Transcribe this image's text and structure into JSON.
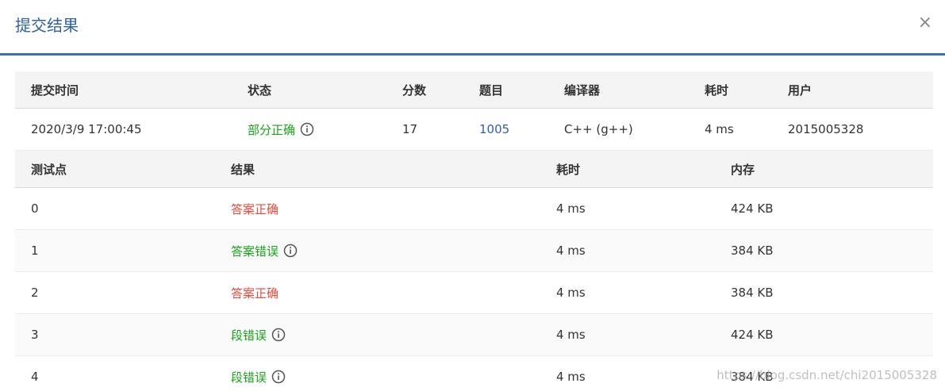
{
  "dialog": {
    "title": "提交结果",
    "close_label": "×"
  },
  "submission": {
    "headers": [
      "提交时间",
      "状态",
      "分数",
      "题目",
      "编译器",
      "耗时",
      "用户"
    ],
    "values": {
      "time": "2020/3/9 17:00:45",
      "status": "部分正确",
      "score": "17",
      "problem": "1005",
      "compiler": "C++ (g++)",
      "duration": "4 ms",
      "user": "2015005328"
    }
  },
  "testcases": {
    "headers": [
      "测试点",
      "结果",
      "耗时",
      "内存"
    ],
    "rows": [
      {
        "id": "0",
        "result": "答案正确",
        "time": "4 ms",
        "memory": "424 KB"
      },
      {
        "id": "1",
        "result": "答案错误",
        "time": "4 ms",
        "memory": "384 KB"
      },
      {
        "id": "2",
        "result": "答案正确",
        "time": "4 ms",
        "memory": "384 KB"
      },
      {
        "id": "3",
        "result": "段错误",
        "time": "4 ms",
        "memory": "424 KB"
      },
      {
        "id": "4",
        "result": "段错误",
        "time": "4 ms",
        "memory": "384 KB"
      }
    ]
  },
  "watermark": "https://blog.csdn.net/chi2015005328",
  "colors": {
    "accent": "#3d6dbd",
    "success": "#e74c3c",
    "error": "#18a418"
  }
}
